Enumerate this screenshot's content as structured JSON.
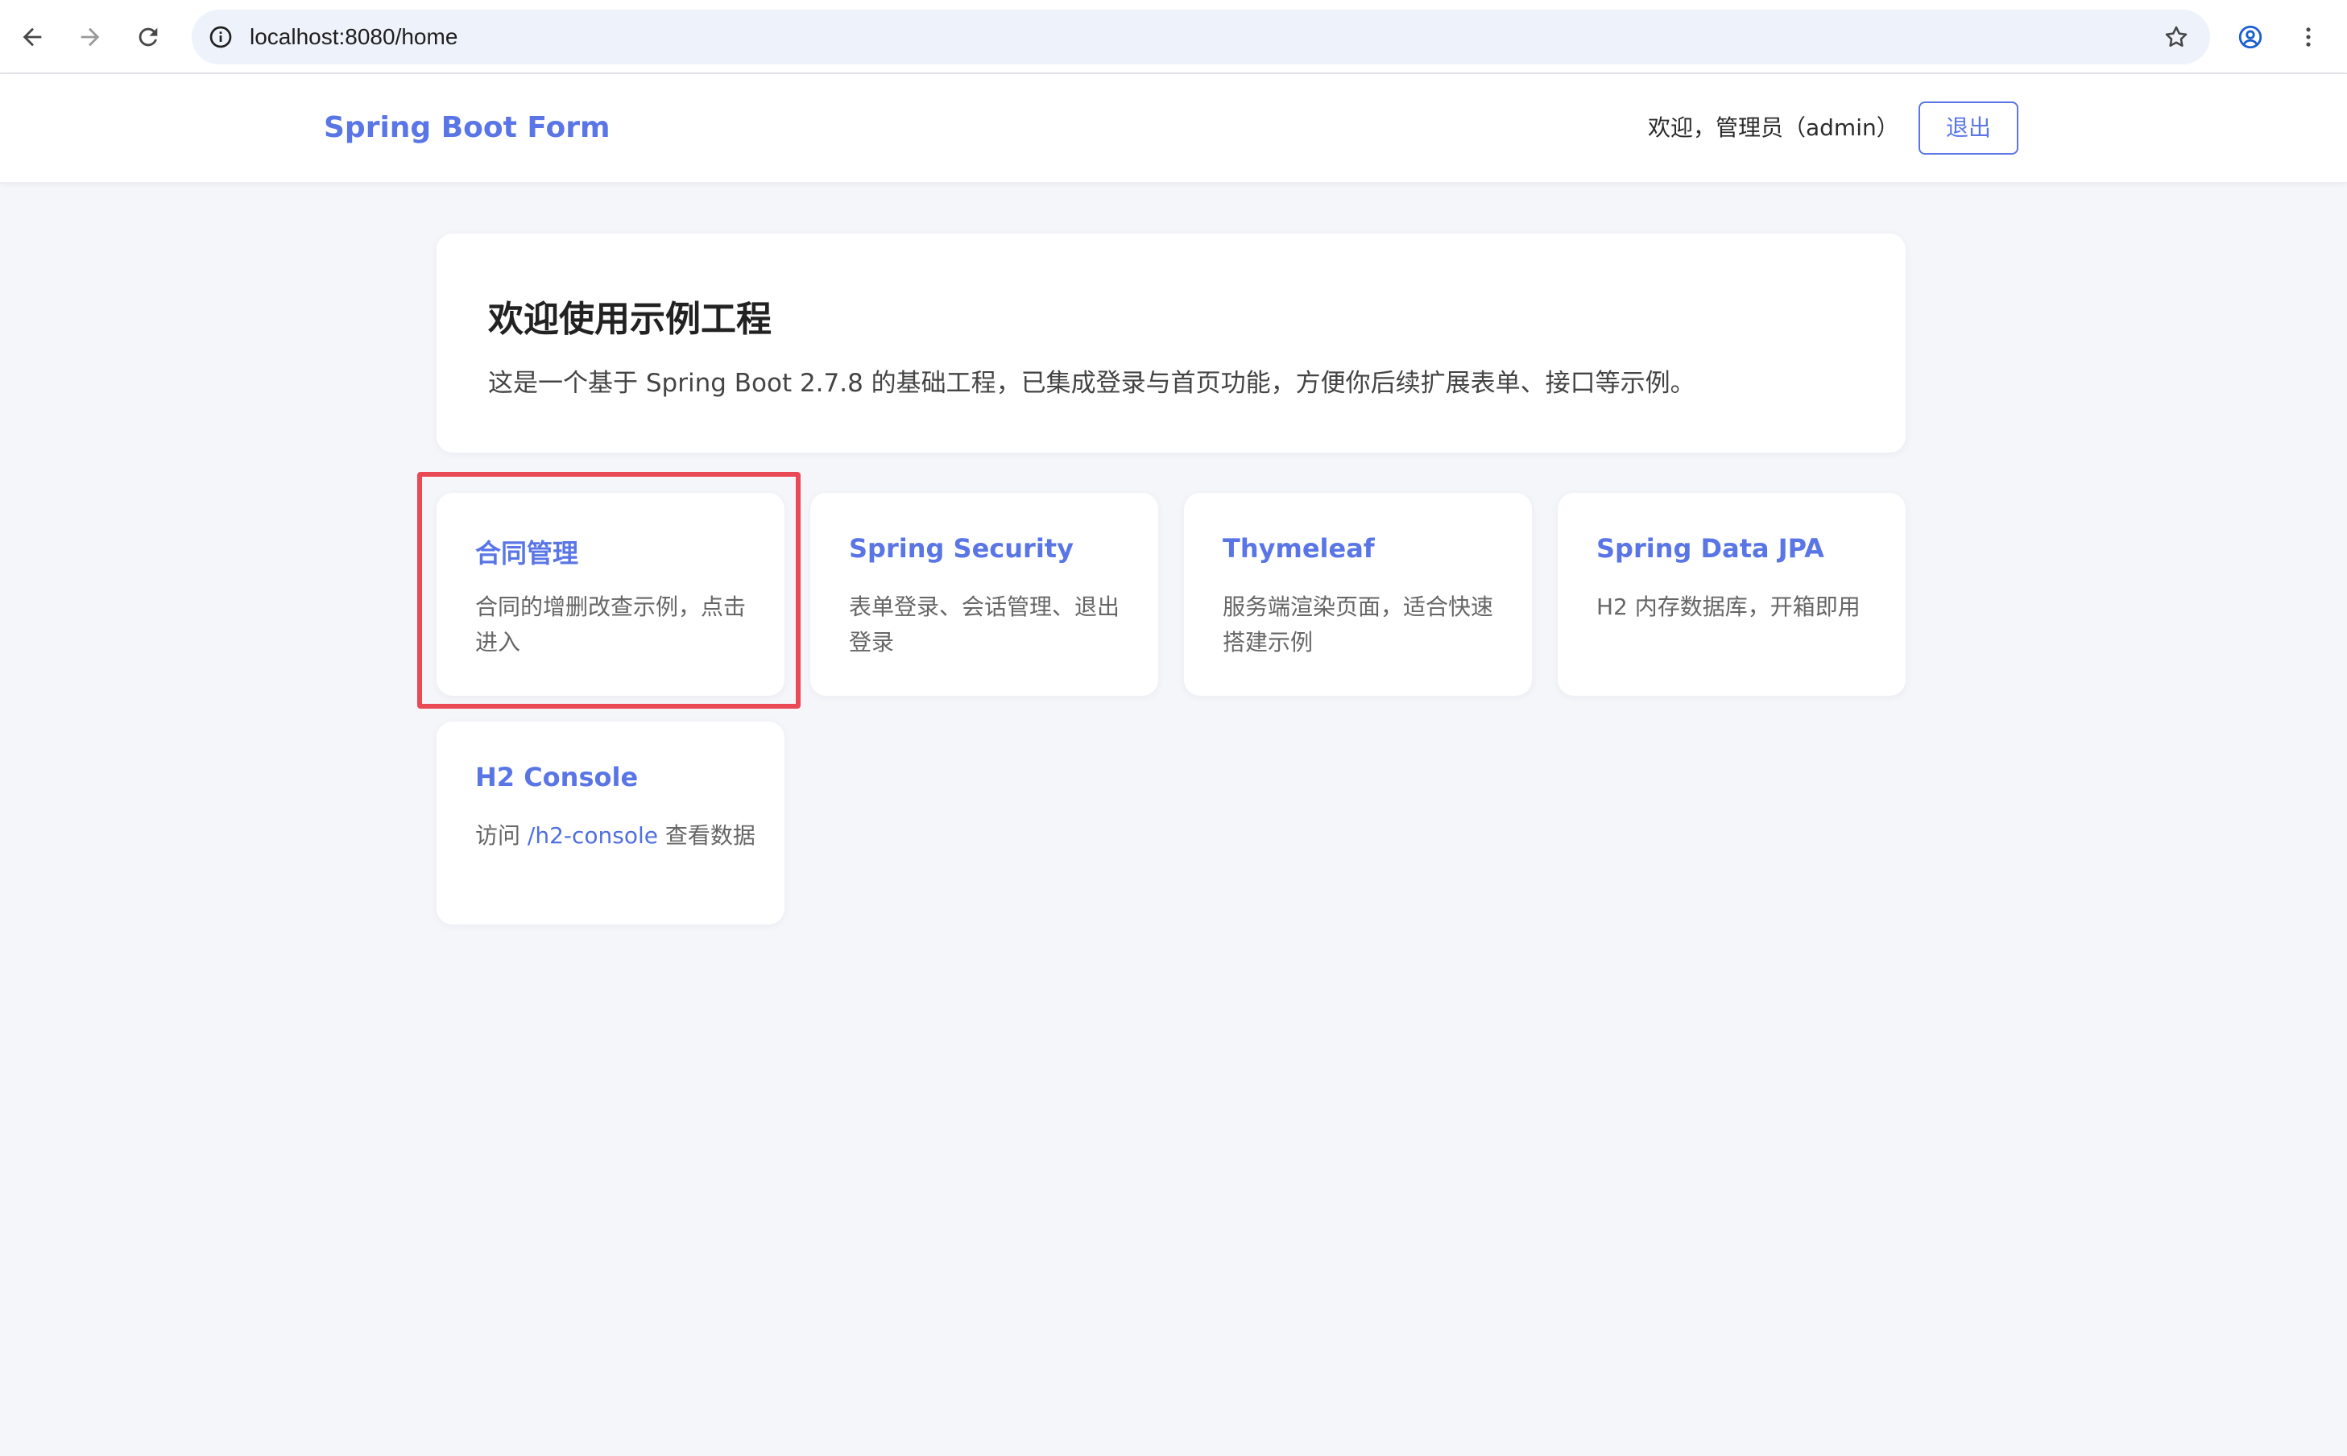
{
  "browser": {
    "url": "localhost:8080/home"
  },
  "header": {
    "brand": "Spring Boot Form",
    "welcome": "欢迎，管理员（admin）",
    "logout_label": "退出"
  },
  "hero": {
    "title": "欢迎使用示例工程",
    "description": "这是一个基于 Spring Boot 2.7.8 的基础工程，已集成登录与首页功能，方便你后续扩展表单、接口等示例。"
  },
  "cards": [
    {
      "title": "合同管理",
      "description": "合同的增删改查示例，点击进入"
    },
    {
      "title": "Spring Security",
      "description": "表单登录、会话管理、退出登录"
    },
    {
      "title": "Thymeleaf",
      "description": "服务端渲染页面，适合快速搭建示例"
    },
    {
      "title": "Spring Data JPA",
      "description": "H2 内存数据库，开箱即用"
    },
    {
      "title": "H2 Console",
      "desc_prefix": "访问 ",
      "desc_link": "/h2-console",
      "desc_suffix": " 查看数据"
    }
  ],
  "colors": {
    "accent": "#5a76e6",
    "highlight": "#ea4a55",
    "page_bg": "#f5f6fa"
  }
}
